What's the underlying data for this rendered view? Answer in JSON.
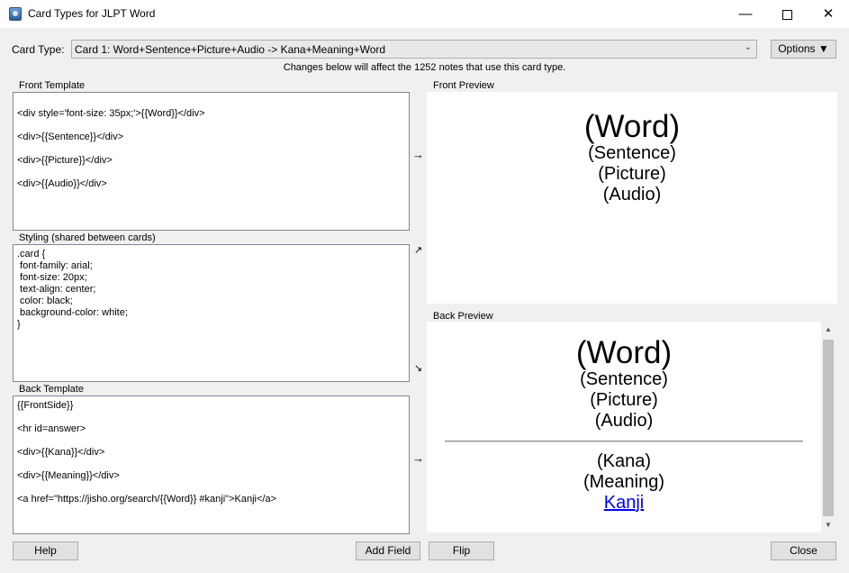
{
  "window": {
    "title": "Card Types for JLPT Word",
    "min_glyph": "—",
    "close_glyph": "✕"
  },
  "toolbar": {
    "card_type_label": "Card Type:",
    "card_type_value": "Card 1: Word+Sentence+Picture+Audio -> Kana+Meaning+Word",
    "options_label": "Options ▼",
    "dropdown_glyph": "⌄",
    "notice": "Changes below will affect the 1252 notes that use this card type."
  },
  "front_template": {
    "title": "Front Template",
    "lines": [
      "",
      "<div style='font-size: 35px;'>{{Word}}</div>",
      "",
      "<div>{{Sentence}}</div>",
      "",
      "<div>{{Picture}}</div>",
      "",
      "<div>{{Audio}}</div>"
    ]
  },
  "styling": {
    "title": "Styling (shared between cards)",
    "lines": [
      ".card {",
      " font-family: arial;",
      " font-size: 20px;",
      " text-align: center;",
      " color: black;",
      " background-color: white;",
      "}"
    ]
  },
  "back_template": {
    "title": "Back Template",
    "lines": [
      "{{FrontSide}}",
      "",
      "<hr id=answer>",
      "",
      "<div>{{Kana}}</div>",
      "",
      "<div>{{Meaning}}</div>",
      "",
      "<a href=\"https://jisho.org/search/{{Word}} #kanji\">Kanji</a>"
    ]
  },
  "arrows": {
    "front": "→",
    "styling_up": "↗",
    "styling_down": "↘",
    "back": "→"
  },
  "front_preview": {
    "title": "Front Preview",
    "word": "(Word)",
    "sentence": "(Sentence)",
    "picture": "(Picture)",
    "audio": "(Audio)"
  },
  "back_preview": {
    "title": "Back Preview",
    "word": "(Word)",
    "sentence": "(Sentence)",
    "picture": "(Picture)",
    "audio": "(Audio)",
    "kana": "(Kana)",
    "meaning": "(Meaning)",
    "kanji_link": "Kanji",
    "scroll_up_glyph": "▲",
    "scroll_down_glyph": "▼"
  },
  "buttons": {
    "help": "Help",
    "add_field": "Add Field",
    "flip": "Flip",
    "close": "Close"
  },
  "colors": {
    "window_bg": "#f0f0f0",
    "link": "#0000ee"
  }
}
